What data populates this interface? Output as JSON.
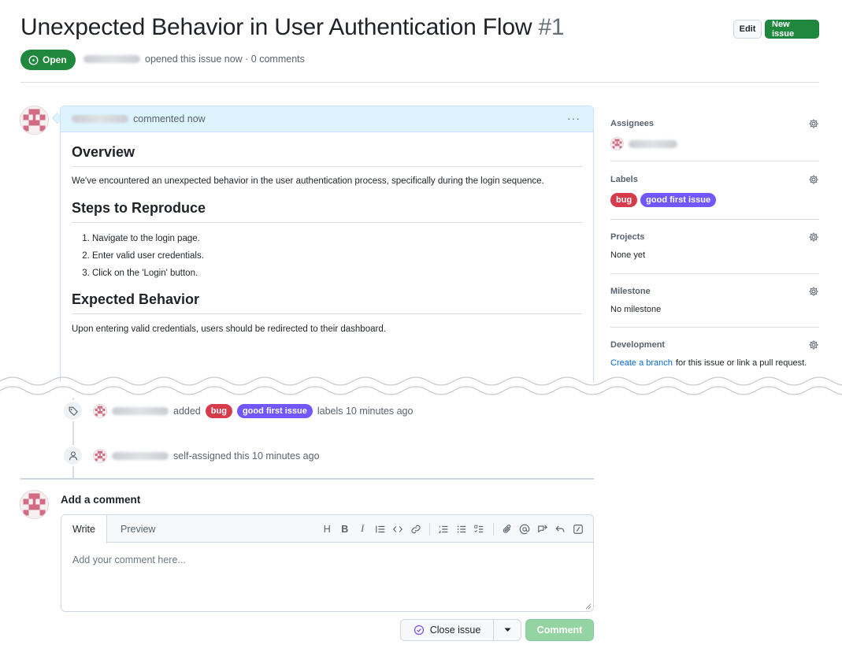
{
  "header": {
    "title": "Unexpected Behavior in User Authentication Flow",
    "number": "#1",
    "edit_label": "Edit",
    "new_issue_label": "New issue",
    "status_label": "Open",
    "meta_text": "opened this issue now · 0 comments"
  },
  "comment": {
    "header_text": "commented now",
    "menu_glyph": "···",
    "overview_heading": "Overview",
    "overview_text": "We've encountered an unexpected behavior in the user authentication process, specifically during the login sequence.",
    "steps_heading": "Steps to Reproduce",
    "steps": [
      "Navigate to the login page.",
      "Enter valid user credentials.",
      "Click on the 'Login' button."
    ],
    "expected_heading": "Expected Behavior",
    "expected_text": "Upon entering valid credentials, users should be redirected to their dashboard."
  },
  "timeline": {
    "labels_event": {
      "prefix": "added",
      "suffix": "labels 10 minutes ago"
    },
    "assign_event": {
      "text": "self-assigned this 10 minutes ago"
    }
  },
  "labels": [
    {
      "name": "bug",
      "color": "#d73a4a"
    },
    {
      "name": "good first issue",
      "color": "#7057ff"
    }
  ],
  "add_comment": {
    "title": "Add a comment",
    "tab_write": "Write",
    "tab_preview": "Preview",
    "placeholder": "Add your comment here...",
    "toolbar_icons": [
      "heading-icon",
      "bold-icon",
      "italic-icon",
      "quote-icon",
      "code-icon",
      "link-icon",
      "ordered-list-icon",
      "unordered-list-icon",
      "task-list-icon",
      "attach-icon",
      "mention-icon",
      "cross-reference-icon",
      "reply-icon",
      "slash-command-icon"
    ],
    "close_issue_label": "Close issue",
    "comment_label": "Comment"
  },
  "sidebar": {
    "assignees": {
      "title": "Assignees"
    },
    "labels": {
      "title": "Labels"
    },
    "projects": {
      "title": "Projects",
      "value": "None yet"
    },
    "milestone": {
      "title": "Milestone",
      "value": "No milestone"
    },
    "development": {
      "title": "Development",
      "link_text": "Create a branch",
      "rest_text": "for this issue or link a pull request."
    }
  },
  "colors": {
    "open_green": "#1f883d",
    "comment_header_bg": "#ddf4ff",
    "link_blue": "#0969da",
    "comment_button_disabled": "#94d3a2"
  }
}
